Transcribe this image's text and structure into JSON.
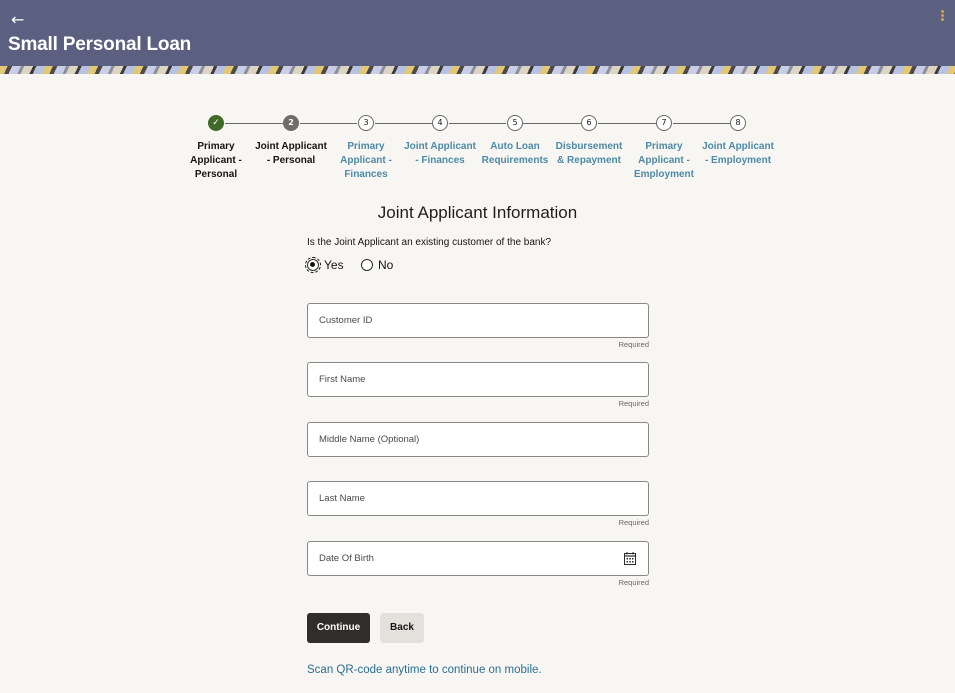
{
  "header": {
    "back_icon": "arrow-left-icon",
    "title": "Small Personal Loan",
    "menu_icon": "kebab-menu-icon",
    "accent_color": "#d9a03a",
    "background_color": "#5b6081"
  },
  "stepper": {
    "steps": [
      {
        "number": "✓",
        "label_lines": [
          "Primary",
          "Applicant -",
          "Personal"
        ],
        "state": "completed"
      },
      {
        "number": "2",
        "label_lines": [
          "Joint Applicant",
          "- Personal"
        ],
        "state": "current"
      },
      {
        "number": "3",
        "label_lines": [
          "Primary",
          "Applicant -",
          "Finances"
        ],
        "state": "upcoming"
      },
      {
        "number": "4",
        "label_lines": [
          "Joint Applicant",
          "- Finances"
        ],
        "state": "upcoming"
      },
      {
        "number": "5",
        "label_lines": [
          "Auto Loan",
          "Requirements"
        ],
        "state": "upcoming"
      },
      {
        "number": "6",
        "label_lines": [
          "Disbursement",
          "& Repayment"
        ],
        "state": "upcoming"
      },
      {
        "number": "7",
        "label_lines": [
          "Primary",
          "Applicant -",
          "Employment"
        ],
        "state": "upcoming"
      },
      {
        "number": "8",
        "label_lines": [
          "Joint Applicant",
          "- Employment"
        ],
        "state": "upcoming"
      }
    ]
  },
  "form": {
    "section_title": "Joint Applicant Information",
    "question": "Is the Joint Applicant an existing customer of the bank?",
    "radio_yes": "Yes",
    "radio_no": "No",
    "selected": "Yes",
    "fields": {
      "customer_id": {
        "label": "Customer ID",
        "value": "",
        "hint": "Required"
      },
      "first_name": {
        "label": "First Name",
        "value": "",
        "hint": "Required"
      },
      "middle_name": {
        "label": "Middle Name (Optional)",
        "value": "",
        "hint": ""
      },
      "last_name": {
        "label": "Last Name",
        "value": "",
        "hint": "Required"
      },
      "date_of_birth": {
        "label": "Date Of Birth",
        "value": "",
        "hint": "Required",
        "icon": "calendar-icon"
      }
    }
  },
  "actions": {
    "continue_label": "Continue",
    "back_label": "Back"
  },
  "footer": {
    "qr_text": "Scan QR-code anytime to continue on mobile."
  },
  "colors": {
    "link": "#2a6f93",
    "step_done": "#3f6a28",
    "primary_button": "#312d2a"
  }
}
